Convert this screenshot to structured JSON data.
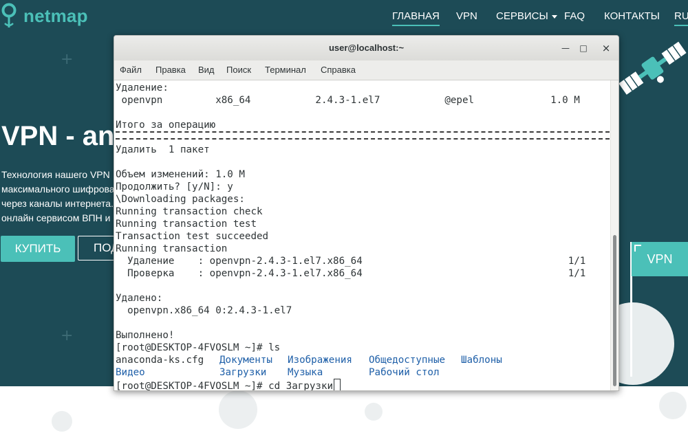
{
  "site": {
    "logo_text": "netmap",
    "nav": [
      "ГЛАВНАЯ",
      "VPN",
      "СЕРВИСЫ",
      "FAQ",
      "КОНТАКТЫ",
      "RU"
    ],
    "hero_title": "VPN - an",
    "hero_lines": [
      "Технология нашего VPN",
      "максимального шифрова",
      "через каналы интернета.",
      "онлайн сервисом ВПН и"
    ],
    "buy_button": "КУПИТЬ",
    "more_button": "ПОД",
    "flag_label": "VPN",
    "colors": {
      "background": "#1d4b56",
      "accent": "#4bc0b8"
    }
  },
  "terminal": {
    "title": "user@localhost:~",
    "controls": {
      "minimize": "—",
      "maximize": "□",
      "close": "×"
    },
    "menu": [
      "Файл",
      "Правка",
      "Вид",
      "Поиск",
      "Терминал",
      "Справка"
    ],
    "lines": [
      "Удаление:",
      " openvpn         x86_64           2.4.3-1.el7           @epel             1.0 M",
      "",
      "Итого за операцию",
      "",
      "Удалить  1 пакет",
      "",
      "Объем изменений: 1.0 M",
      "Продолжить? [y/N]: y",
      "\\Downloading packages:",
      "Running transaction check",
      "Running transaction test",
      "Transaction test succeeded",
      "Running transaction",
      "  Удаление    : openvpn-2.4.3-1.el7.x86_64                                   1/1",
      "  Проверка    : openvpn-2.4.3-1.el7.x86_64                                   1/1",
      "",
      "Удалено:",
      "  openvpn.x86_64 0:2.4.3-1.el7",
      "",
      "Выполнено!",
      "[root@DESKTOP-4FVOSLM ~]# ls"
    ],
    "ls_output": [
      [
        "anaconda-ks.cfg",
        "Документы",
        "Изображения",
        "Общедоступные",
        "Шаблоны"
      ],
      [
        "Видео",
        "Загрузки",
        "Музыка",
        "Рабочий стол"
      ]
    ],
    "prompt_line": "[root@DESKTOP-4FVOSLM ~]# cd Загрузки"
  }
}
